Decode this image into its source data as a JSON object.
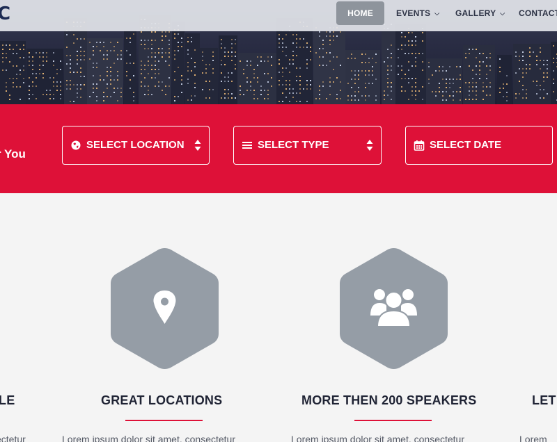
{
  "nav": {
    "logo_fragment": "C",
    "items": [
      {
        "label": "HOME",
        "active": true
      },
      {
        "label": "EVENTS",
        "has_dropdown": true
      },
      {
        "label": "GALLERY",
        "has_dropdown": true
      },
      {
        "label": "CONTACT",
        "has_dropdown": false
      }
    ]
  },
  "search": {
    "tagline": "r You",
    "location_label": "SELECT LOCATION",
    "type_label": "SELECT TYPE",
    "date_label": "SELECT DATE"
  },
  "features": {
    "left_partial_title": "LE",
    "left_partial_desc": "ectetur",
    "items": [
      {
        "title": "GREAT LOCATIONS",
        "icon": "map-marker-icon",
        "desc": "Lorem ipsum dolor sit amet, consectetur"
      },
      {
        "title": "MORE THEN 200 SPEAKERS",
        "icon": "users-group-icon",
        "desc": "Lorem ipsum dolor sit amet, consectetur"
      }
    ],
    "right_partial_title": "LET",
    "right_partial_desc": "Lorem"
  },
  "colors": {
    "accent_red": "#de1138",
    "hex_gray": "#959da6",
    "nav_active_bg": "#8e949c",
    "page_bg": "#f4f4f4",
    "heading": "#1f2334"
  }
}
